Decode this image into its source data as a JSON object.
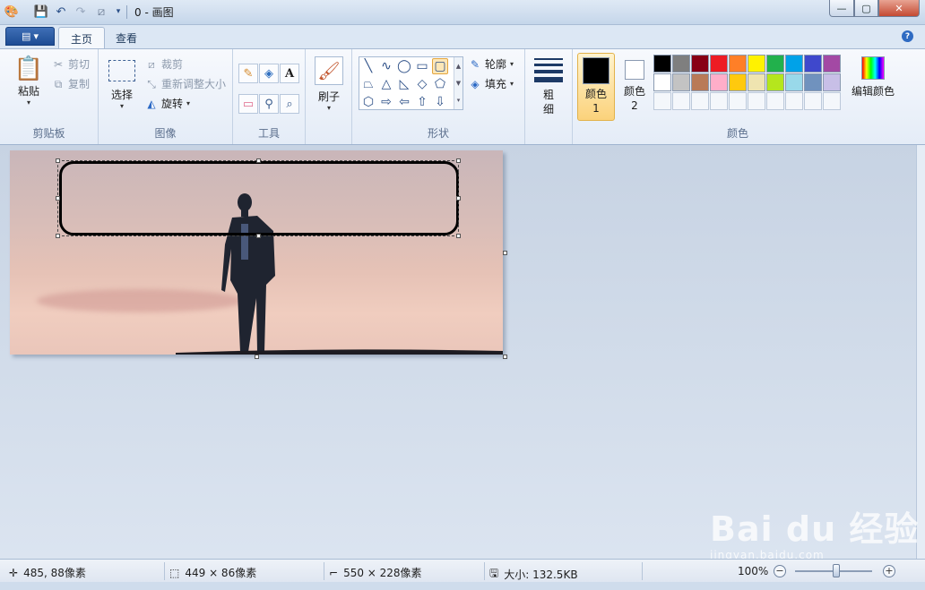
{
  "window": {
    "title": "0 - 画图",
    "controls": {
      "minimize": "—",
      "maximize": "▢",
      "close": "✕"
    }
  },
  "quick_access": {
    "icons": [
      "paint-app-icon",
      "save-icon",
      "undo-icon",
      "redo-icon",
      "crop-qa-icon",
      "customize-dropdown-icon"
    ]
  },
  "tabs": {
    "file_caret": "▾",
    "home": "主页",
    "view": "查看",
    "help": "?"
  },
  "ribbon": {
    "clipboard": {
      "label": "剪贴板",
      "paste": "粘贴",
      "cut": "剪切",
      "copy": "复制"
    },
    "image": {
      "label": "图像",
      "select": "选择",
      "crop": "裁剪",
      "resize": "重新调整大小",
      "rotate": "旋转"
    },
    "tools": {
      "label": "工具"
    },
    "brushes": {
      "label": "刷子"
    },
    "shapes": {
      "label": "形状",
      "outline": "轮廓",
      "fill": "填充"
    },
    "size": {
      "label": "粗细"
    },
    "colors": {
      "label": "颜色",
      "color1": "颜色 1",
      "color2": "颜色 2",
      "edit": "编辑颜色",
      "color1_value": "#000000",
      "color2_value": "#ffffff",
      "palette": [
        "#000000",
        "#7f7f7f",
        "#880015",
        "#ed1c24",
        "#ff7f27",
        "#fff200",
        "#22b14c",
        "#00a2e8",
        "#3f48cc",
        "#a349a4",
        "#ffffff",
        "#c3c3c3",
        "#b97a57",
        "#ffaec9",
        "#ffc90e",
        "#efe4b0",
        "#b5e61d",
        "#99d9ea",
        "#7092be",
        "#c8bfe7"
      ]
    }
  },
  "statusbar": {
    "cursor": "485, 88像素",
    "selection": "449 × 86像素",
    "canvas_size": "550 × 228像素",
    "file_size": "大小: 132.5KB",
    "zoom": "100%",
    "zoom_level": 1.0
  },
  "watermark": {
    "brand": "Bai du 经验",
    "url": "jingyan.baidu.com"
  }
}
